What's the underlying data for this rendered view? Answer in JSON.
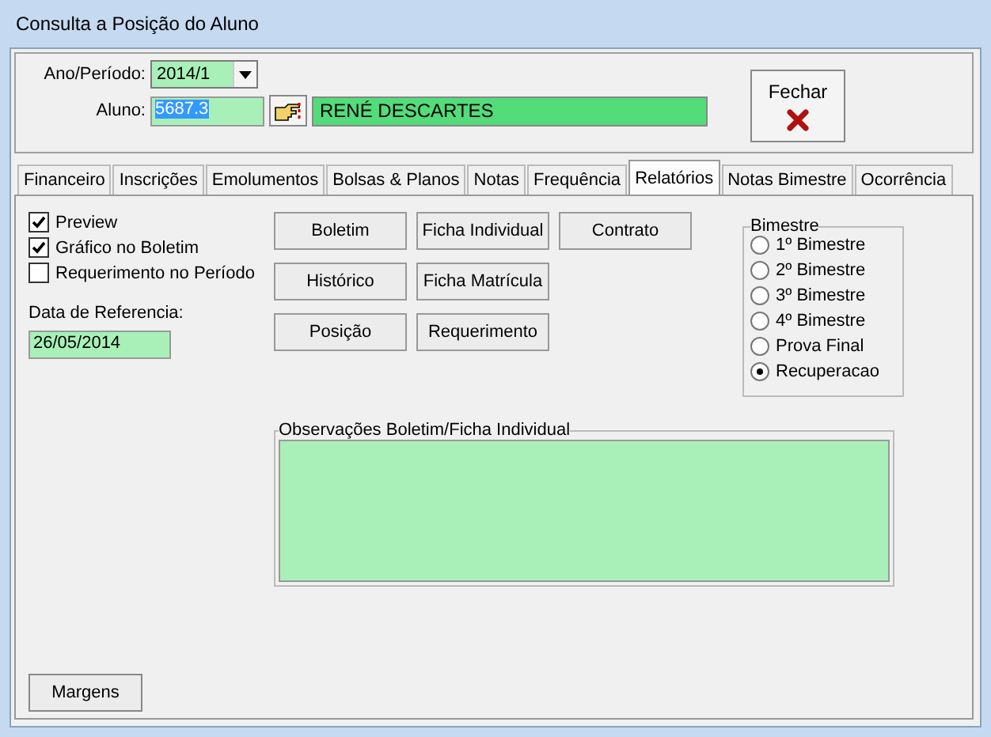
{
  "window": {
    "title": "Consulta a Posição do Aluno"
  },
  "ano_periodo": {
    "label": "Ano/Período:",
    "value": "2014/1"
  },
  "aluno": {
    "label": "Aluno:",
    "code": "5687.3",
    "name": "RENÉ DESCARTES"
  },
  "close_button": {
    "label": "Fechar"
  },
  "tabs": [
    {
      "label": "Financeiro",
      "selected": false
    },
    {
      "label": "Inscrições",
      "selected": false
    },
    {
      "label": "Emolumentos",
      "selected": false
    },
    {
      "label": "Bolsas & Planos",
      "selected": false
    },
    {
      "label": "Notas",
      "selected": false
    },
    {
      "label": "Frequência",
      "selected": false
    },
    {
      "label": "Relatórios",
      "selected": true
    },
    {
      "label": "Notas Bimestre",
      "selected": false
    },
    {
      "label": "Ocorrência",
      "selected": false
    }
  ],
  "options": [
    {
      "label": "Preview",
      "checked": true
    },
    {
      "label": "Gráfico no Boletim",
      "checked": true
    },
    {
      "label": "Requerimento no Período",
      "checked": false
    }
  ],
  "data_referencia": {
    "label": "Data de Referencia:",
    "value": "26/05/2014"
  },
  "report_buttons": [
    [
      "Boletim",
      "Ficha Individual",
      "Contrato"
    ],
    [
      "Histórico",
      "Ficha Matrícula"
    ],
    [
      "Posição",
      "Requerimento"
    ]
  ],
  "bimestre": {
    "title": "Bimestre",
    "options": [
      {
        "label": "1º Bimestre",
        "selected": false
      },
      {
        "label": "2º Bimestre",
        "selected": false
      },
      {
        "label": "3º Bimestre",
        "selected": false
      },
      {
        "label": "4º Bimestre",
        "selected": false
      },
      {
        "label": "Prova Final",
        "selected": false
      },
      {
        "label": "Recuperacao",
        "selected": true
      }
    ]
  },
  "observacoes": {
    "title": "Observações Boletim/Ficha Individual"
  },
  "margens_button": {
    "label": "Margens"
  }
}
